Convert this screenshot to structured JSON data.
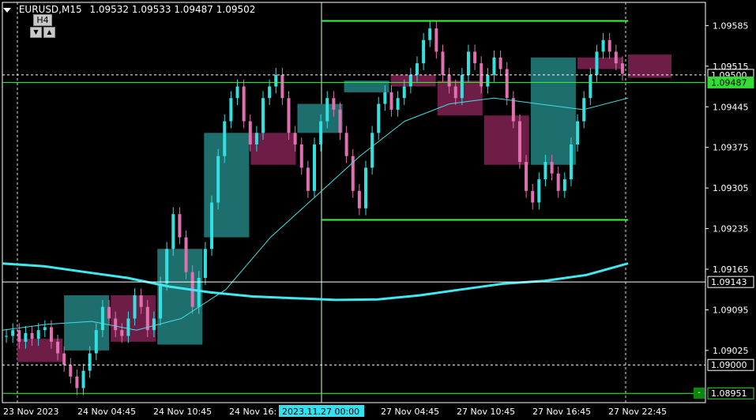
{
  "header": {
    "symbol": "EURUSD,M15",
    "ohlc": "1.09532 1.09533 1.09487 1.09502"
  },
  "timeframe_box": {
    "label": "H4",
    "down": "▼",
    "up": "▲"
  },
  "corner_button": {
    "label": "-"
  },
  "colors": {
    "background": "#000000",
    "bull": "#33e0e0",
    "bear": "#e070b0",
    "htf_bull": "#1e6e6e",
    "htf_bear": "#6e1e46",
    "level_lines": "#33ff33",
    "ma_thick": "#40e8f0",
    "ma_thin": "#40e0e0",
    "axis_text": "#ffffff",
    "grid": "#ffffff"
  },
  "chart_data": {
    "type": "candlestick",
    "symbol": "EURUSD",
    "timeframe": "M15",
    "grid": true,
    "ylim": [
      1.08935,
      1.09625
    ],
    "y_ticks": [
      "1.09585",
      "1.09515",
      "1.09445",
      "1.09375",
      "1.09305",
      "1.09235",
      "1.09165",
      "1.09095",
      "1.09025"
    ],
    "x_ticks": [
      "23 Nov 2023",
      "24 Nov 04:45",
      "24 Nov 10:45",
      "24 Nov 16:",
      "27 Nov 04:45",
      "27 Nov 10:45",
      "27 Nov 16:45",
      "27 Nov 22:45"
    ],
    "crosshair_time": "2023.11.27 00:00",
    "price_labels": [
      {
        "value": 1.095,
        "text": "1.09500",
        "style": "dashed-white"
      },
      {
        "value": 1.09487,
        "text": "1.09487",
        "style": "current"
      },
      {
        "value": 1.09143,
        "text": "1.09143",
        "style": "white-line"
      },
      {
        "value": 1.09,
        "text": "1.09000",
        "style": "dashed-white"
      },
      {
        "value": 1.08951,
        "text": "1.08951",
        "style": "green-line"
      }
    ],
    "levels": [
      {
        "value": 1.09593,
        "from_time": "2023.11.27 00:00"
      },
      {
        "value": 1.09487,
        "from_time": "start"
      },
      {
        "value": 1.0925,
        "from_time": "2023.11.27 00:00"
      },
      {
        "value": 1.08951,
        "from_time": "start"
      }
    ],
    "htf_candles": [
      {
        "open": 1.09045,
        "high": 1.09055,
        "low": 1.09005,
        "close": 1.09005
      },
      {
        "open": 1.09025,
        "high": 1.0912,
        "low": 1.09025,
        "close": 1.0912
      },
      {
        "open": 1.0912,
        "high": 1.0912,
        "low": 1.0904,
        "close": 1.0904
      },
      {
        "open": 1.09035,
        "high": 1.092,
        "low": 1.09035,
        "close": 1.092
      },
      {
        "open": 1.0922,
        "high": 1.094,
        "low": 1.0922,
        "close": 1.094
      },
      {
        "open": 1.094,
        "high": 1.094,
        "low": 1.09345,
        "close": 1.09345
      },
      {
        "open": 1.094,
        "high": 1.0945,
        "low": 1.094,
        "close": 1.0945
      },
      {
        "open": 1.0947,
        "high": 1.0949,
        "low": 1.0947,
        "close": 1.0949
      },
      {
        "open": 1.095,
        "high": 1.095,
        "low": 1.0948,
        "close": 1.0948
      },
      {
        "open": 1.0949,
        "high": 1.0949,
        "low": 1.0943,
        "close": 1.0943
      },
      {
        "open": 1.0943,
        "high": 1.0943,
        "low": 1.09345,
        "close": 1.09345
      },
      {
        "open": 1.09345,
        "high": 1.0953,
        "low": 1.09345,
        "close": 1.0953
      },
      {
        "open": 1.0953,
        "high": 1.0953,
        "low": 1.0951,
        "close": 1.0951
      }
    ],
    "m15_close_path": [
      1.0905,
      1.0906,
      1.0904,
      1.09055,
      1.09045,
      1.0906,
      1.09065,
      1.0904,
      1.0902,
      1.09,
      1.0898,
      1.0896,
      1.0899,
      1.0902,
      1.0906,
      1.091,
      1.0908,
      1.0906,
      1.0905,
      1.0908,
      1.0912,
      1.091,
      1.0906,
      1.0908,
      1.0914,
      1.092,
      1.0926,
      1.0922,
      1.0916,
      1.091,
      1.0915,
      1.092,
      1.0928,
      1.0936,
      1.0942,
      1.0946,
      1.0948,
      1.0942,
      1.0938,
      1.094,
      1.0946,
      1.0948,
      1.095,
      1.0946,
      1.094,
      1.0938,
      1.0934,
      1.093,
      1.0938,
      1.0942,
      1.0946,
      1.0944,
      1.094,
      1.0936,
      1.093,
      1.0927,
      1.0934,
      1.094,
      1.0945,
      1.0947,
      1.0944,
      1.0946,
      1.0948,
      1.095,
      1.0952,
      1.0956,
      1.0958,
      1.0954,
      1.095,
      1.0948,
      1.0946,
      1.095,
      1.0954,
      1.0952,
      1.0948,
      1.095,
      1.0953,
      1.0951,
      1.0946,
      1.0942,
      1.0935,
      1.093,
      1.0928,
      1.0932,
      1.0935,
      1.0933,
      1.093,
      1.0932,
      1.0938,
      1.0942,
      1.0946,
      1.095,
      1.0954,
      1.0956,
      1.0954,
      1.0952,
      1.09502
    ],
    "ma_slow": [
      1.09175,
      1.0917,
      1.0916,
      1.0915,
      1.09135,
      1.09125,
      1.09118,
      1.09115,
      1.09112,
      1.09113,
      1.0912,
      1.0913,
      1.0914,
      1.09145,
      1.09155,
      1.09175
    ],
    "ma_fast": [
      1.0906,
      1.0907,
      1.09075,
      1.0906,
      1.0908,
      1.0913,
      1.0922,
      1.0929,
      1.0936,
      1.0942,
      1.0945,
      1.0946,
      1.0945,
      1.0944,
      1.0946
    ]
  }
}
